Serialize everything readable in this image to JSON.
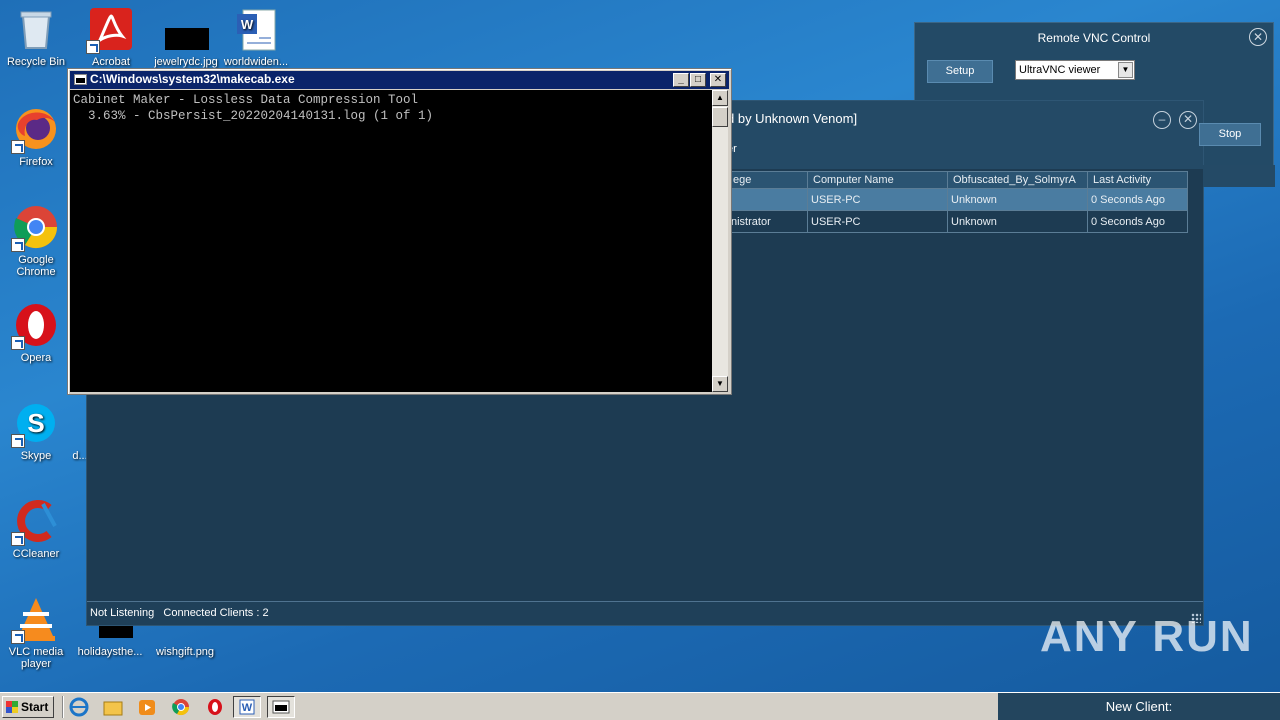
{
  "desktop": {
    "icons": [
      {
        "label": "Recycle Bin",
        "icon": "recycle-bin-icon"
      },
      {
        "label": "Acrobat",
        "icon": "acrobat-icon"
      },
      {
        "label": "jewelrydc.jpg",
        "icon": "image-file-icon"
      },
      {
        "label": "worldwiden...",
        "icon": "word-document-icon"
      },
      {
        "label": "Firefox",
        "icon": "firefox-icon"
      },
      {
        "label": "Google Chrome",
        "icon": "chrome-icon"
      },
      {
        "label": "Opera",
        "icon": "opera-icon"
      },
      {
        "label": "Skype",
        "icon": "skype-icon"
      },
      {
        "label": "d...",
        "icon": "document-icon"
      },
      {
        "label": "CCleaner",
        "icon": "ccleaner-icon"
      },
      {
        "label": "VLC media player",
        "icon": "vlc-icon"
      },
      {
        "label": "holidaysthe...",
        "icon": "image-file-icon"
      },
      {
        "label": "wishgift.png",
        "icon": "image-file-icon"
      }
    ]
  },
  "console": {
    "title": "C:\\Windows\\system32\\makecab.exe",
    "lines": [
      "Cabinet Maker - Lossless Data Compression Tool",
      "",
      "  3.63% - CbsPersist_20220204140131.log (1 of 1)"
    ]
  },
  "vnc": {
    "title": "Remote VNC Control",
    "setup_label": "Setup",
    "viewer_selected": "UltraVNC viewer"
  },
  "rat": {
    "title_fragment": "d by Unknown Venom]",
    "subtitle_fragment": "er",
    "stop_label": "Stop",
    "columns": [
      "ege",
      "Computer Name",
      "Obfuscated_By_SolmyrA",
      "Last Activity"
    ],
    "rows": [
      {
        "privilege": "",
        "computer": "USER-PC",
        "obfuscated": "Unknown",
        "activity": "0 Seconds Ago",
        "selected": true
      },
      {
        "privilege": "nistrator",
        "computer": "USER-PC",
        "obfuscated": "Unknown",
        "activity": "0 Seconds Ago",
        "selected": false
      }
    ],
    "status_listening": "Not Listening",
    "status_clients": "Connected Clients : 2"
  },
  "watermark": "ANY RUN",
  "taskbar": {
    "start_label": "Start",
    "notification": "New Client:"
  },
  "colors": {
    "desktop_blue": "#1f6fb8",
    "rat_bg": "#1d3b52",
    "row_selected": "#4a7ca1",
    "console_title": "#0a246a"
  }
}
